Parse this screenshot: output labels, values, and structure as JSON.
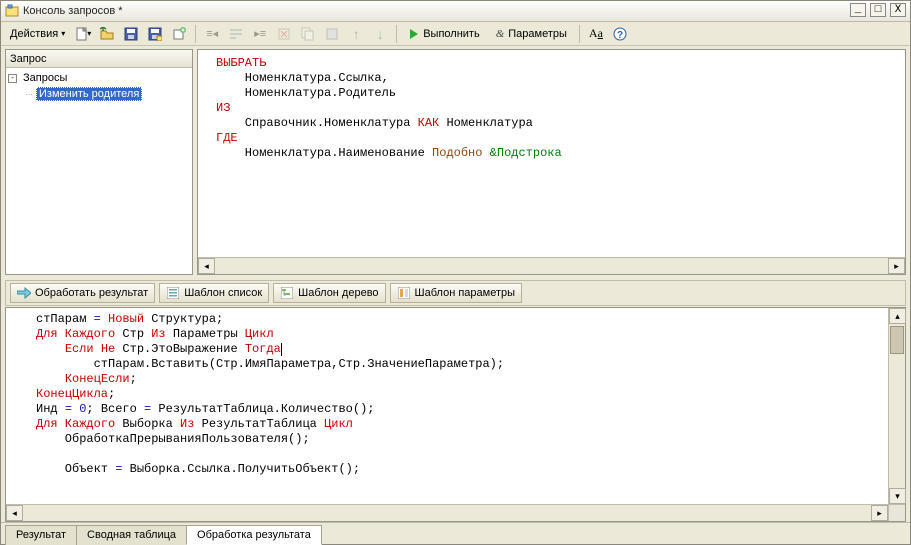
{
  "window": {
    "title": "Консоль запросов *",
    "actions_label": "Действия"
  },
  "toolbar": {
    "run": "Выполнить",
    "params": "Параметры"
  },
  "tree": {
    "header": "Запрос",
    "root": "Запросы",
    "child1": "Изменить родителя"
  },
  "midbar": {
    "process": "Обработать результат",
    "tmpl_list": "Шаблон список",
    "tmpl_tree": "Шаблон дерево",
    "tmpl_params": "Шаблон параметры"
  },
  "tabs": {
    "result": "Результат",
    "pivot": "Сводная таблица",
    "process": "Обработка результата"
  },
  "query": {
    "l1_kw": "ВЫБРАТЬ",
    "l2_t": "    Номенклатура.Ссылка,",
    "l3_t": "    Номенклатура.Родитель",
    "l4_kw": "ИЗ",
    "l5_a": "    Справочник.Номенклатура ",
    "l5_kw": "КАК",
    "l5_b": " Номенклатура",
    "l6_kw": "ГДЕ",
    "l7_a": "    Номенклатура.Наименование ",
    "l7_kw": "Подобно",
    "l7_b": " ",
    "l7_par": "&Подстрока"
  },
  "code": {
    "l1_a": "стПарам ",
    "l1_eq": "= ",
    "l1_kw": "Новый",
    "l1_b": " Структура;",
    "l2_a": "Для Каждого",
    "l2_b": " Стр ",
    "l2_c": "Из",
    "l2_d": " Параметры ",
    "l2_e": "Цикл",
    "l3_a": "    ",
    "l3_b": "Если Не",
    "l3_c": " Стр.ЭтоВыражение ",
    "l3_d": "Тогда",
    "l4_a": "        стПарам.Вставить(Стр.ИмяПараметра,Стр.ЗначениеПараметра);",
    "l5_a": "    ",
    "l5_b": "КонецЕсли",
    "l5_c": ";",
    "l6_a": "КонецЦикла",
    "l6_b": ";",
    "l7_a": "Инд ",
    "l7_eq": "=",
    "l7_b": " 0",
    "l7_c": "; Всего ",
    "l7_eq2": "=",
    "l7_d": " РезультатТаблица.Количество();",
    "l8_a": "Для Каждого",
    "l8_b": " Выборка ",
    "l8_c": "Из",
    "l8_d": " РезультатТаблица ",
    "l8_e": "Цикл",
    "l9_a": "    ОбработкаПрерыванияПользователя();",
    "l10_a": "",
    "l11_a": "    Объект ",
    "l11_eq": "=",
    "l11_b": " Выборка.Ссылка.ПолучитьОбъект();"
  }
}
